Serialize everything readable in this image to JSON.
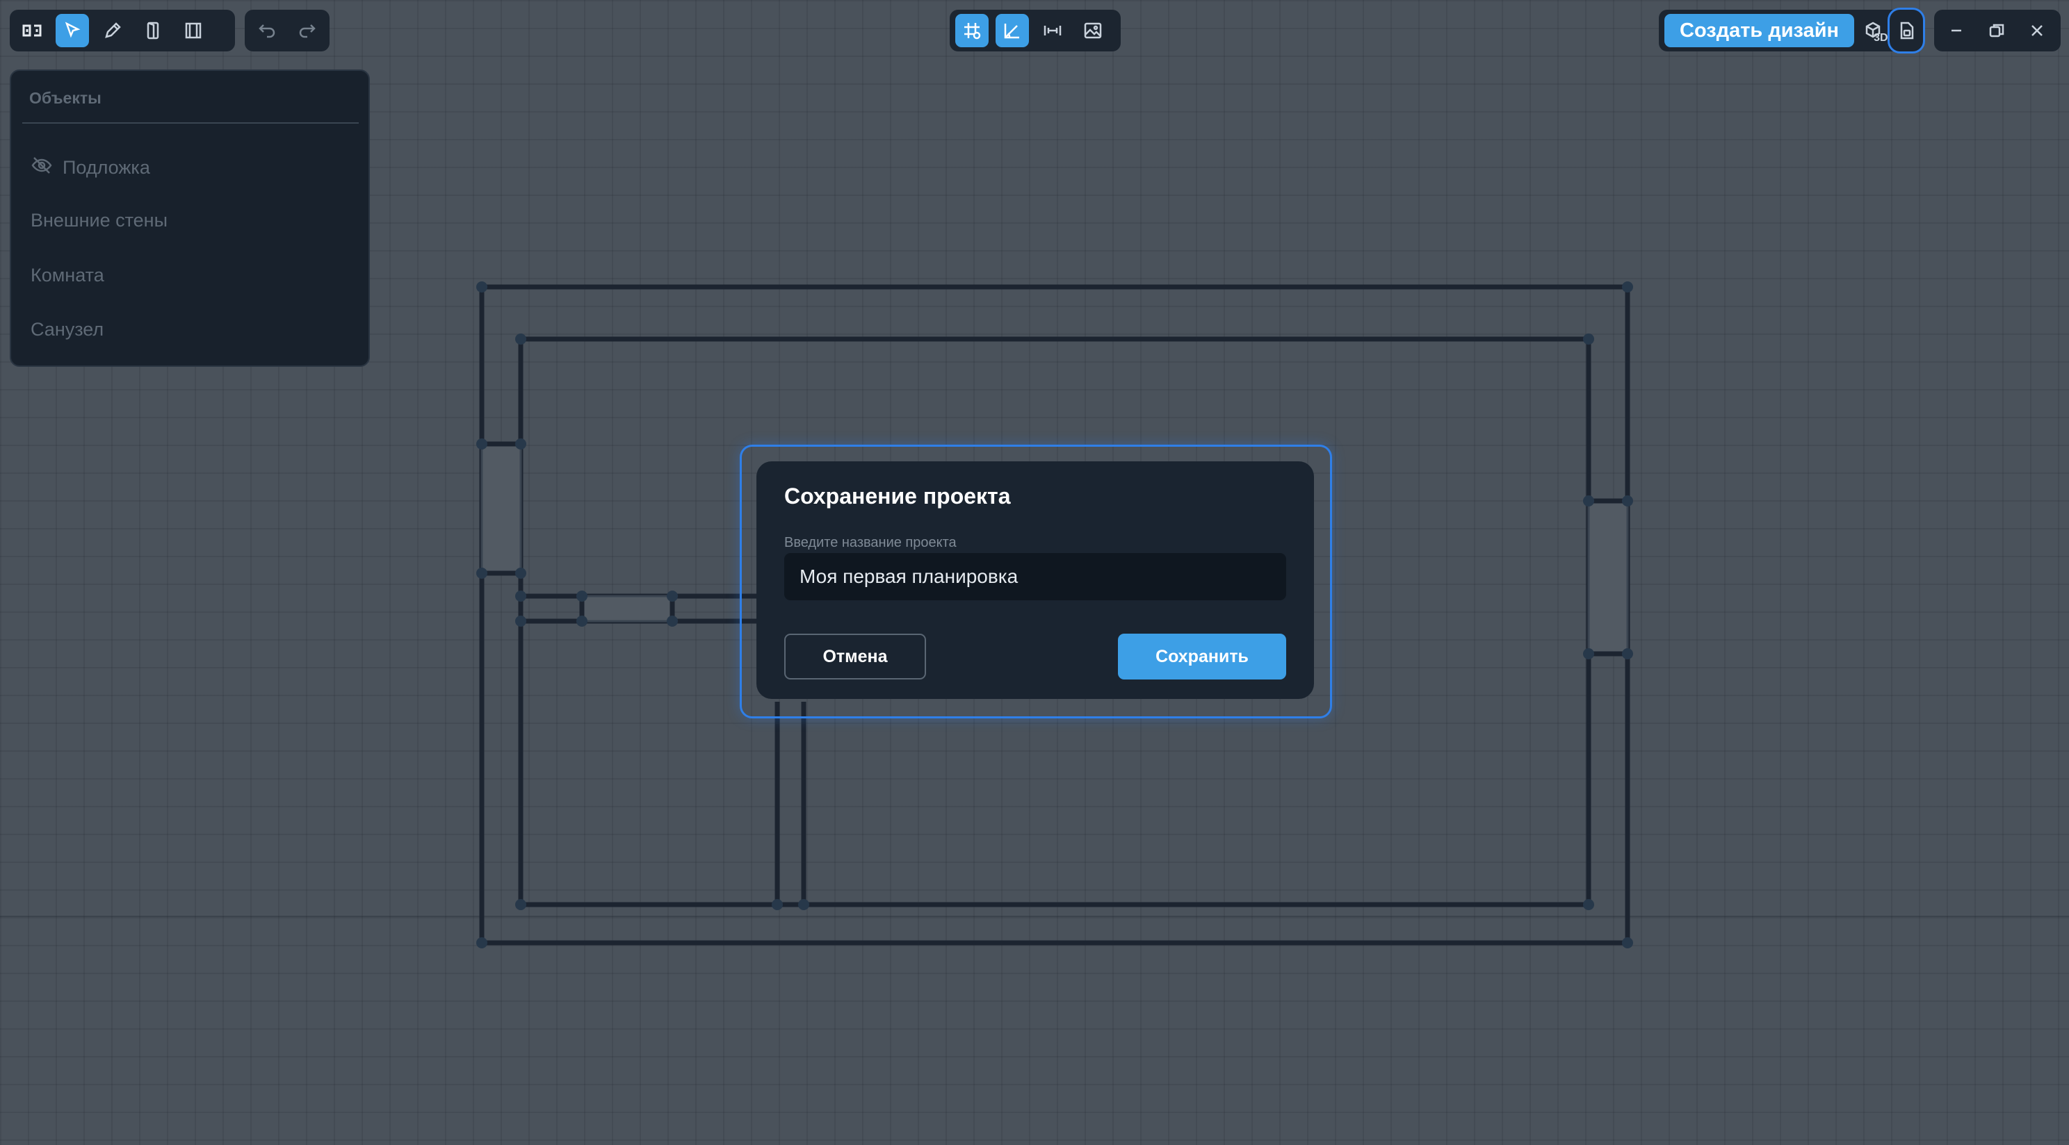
{
  "colors": {
    "accent": "#3d9fe6",
    "canvas": "#4a525b",
    "panel": "#18212c",
    "wall": "#1c2430"
  },
  "toolbar_left": {
    "items": [
      {
        "icon": "logo-icon"
      },
      {
        "icon": "select-arrow-icon",
        "active": true
      },
      {
        "icon": "pencil-icon"
      },
      {
        "icon": "door-icon"
      },
      {
        "icon": "window-icon"
      }
    ],
    "history": [
      {
        "icon": "undo-icon"
      },
      {
        "icon": "redo-icon"
      }
    ]
  },
  "toolbar_center": {
    "items": [
      {
        "icon": "grid-snap-icon",
        "active": true
      },
      {
        "icon": "angle-snap-icon",
        "active": true
      },
      {
        "icon": "dimensions-icon"
      },
      {
        "icon": "image-icon"
      }
    ]
  },
  "toolbar_right": {
    "create_design_label": "Создать дизайн",
    "view3d_badge": "3D",
    "save_icon": "save-file-icon"
  },
  "window_controls": [
    {
      "icon": "minimize-icon"
    },
    {
      "icon": "restore-icon"
    },
    {
      "icon": "close-icon"
    }
  ],
  "objects_panel": {
    "title": "Объекты",
    "items": [
      {
        "label": "Подложка",
        "icon": "eye-off-icon"
      },
      {
        "label": "Внешние стены"
      },
      {
        "label": "Комната"
      },
      {
        "label": "Санузел"
      }
    ]
  },
  "dialog": {
    "title": "Сохранение проекта",
    "label": "Введите название проекта",
    "input_value": "Моя первая планировка",
    "cancel_label": "Отмена",
    "save_label": "Сохранить"
  }
}
